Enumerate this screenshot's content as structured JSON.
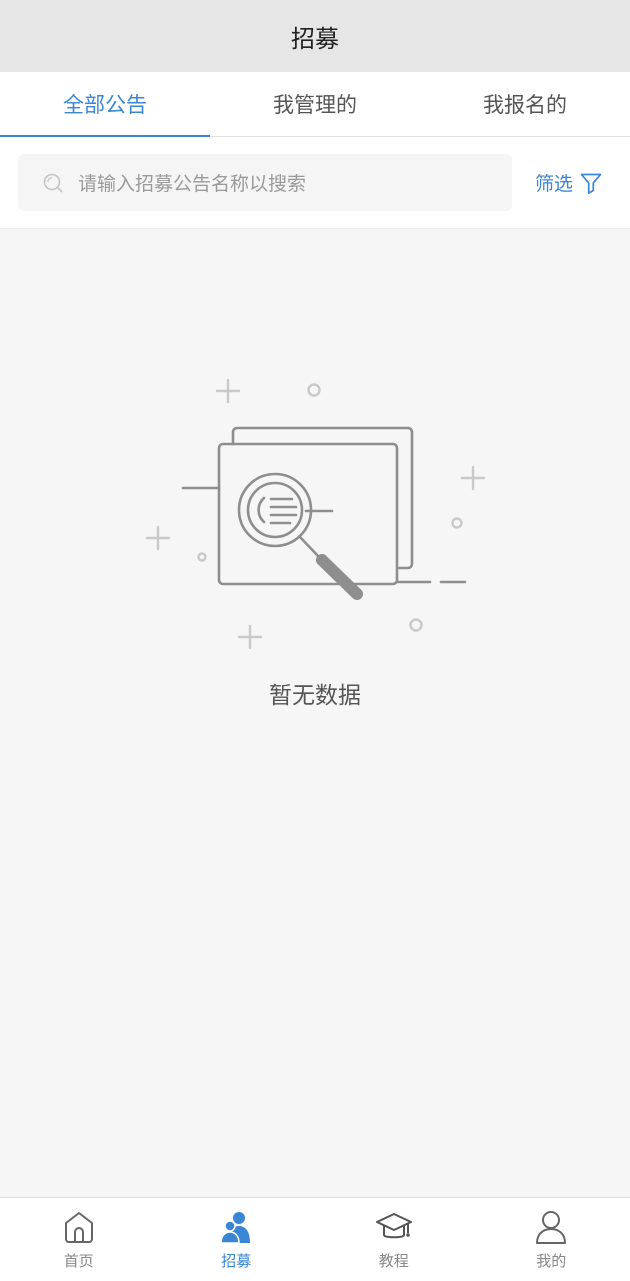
{
  "header": {
    "title": "招募"
  },
  "tabs": [
    {
      "label": "全部公告",
      "active": true
    },
    {
      "label": "我管理的",
      "active": false
    },
    {
      "label": "我报名的",
      "active": false
    }
  ],
  "search": {
    "placeholder": "请输入招募公告名称以搜索",
    "icon": "search-icon"
  },
  "filter": {
    "label": "筛选",
    "icon": "filter-icon"
  },
  "empty_state": {
    "message": "暂无数据",
    "illustration": "magnifier-over-documents"
  },
  "tabbar": [
    {
      "label": "首页",
      "icon": "home-icon",
      "active": false
    },
    {
      "label": "招募",
      "icon": "people-icon",
      "active": true
    },
    {
      "label": "教程",
      "icon": "graduation-cap-icon",
      "active": false
    },
    {
      "label": "我的",
      "icon": "person-icon",
      "active": false
    }
  ],
  "colors": {
    "accent": "#3a86d6",
    "header_bg": "#e6e6e6",
    "page_bg": "#f6f6f6",
    "inactive_text": "#888888"
  }
}
